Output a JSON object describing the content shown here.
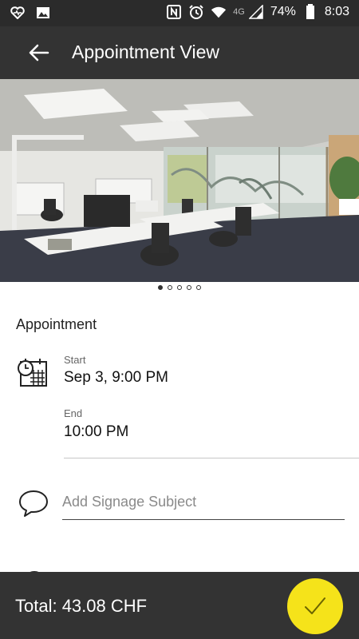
{
  "status_bar": {
    "icons_left": [
      "heart-pulse-icon",
      "image-icon"
    ],
    "icons_right": [
      "nfc-icon",
      "alarm-icon",
      "wifi-icon",
      "signal-icon",
      "battery-icon"
    ],
    "network": "4G",
    "battery": "74%",
    "time": "8:03"
  },
  "app_bar": {
    "title": "Appointment View",
    "back_icon": "arrow-left-icon"
  },
  "carousel": {
    "image": "office-photo",
    "pages": 5,
    "current": 1
  },
  "appointment": {
    "section_title": "Appointment",
    "start_label": "Start",
    "start_value": "Sep 3, 9:00 PM",
    "end_label": "End",
    "end_value": "10:00 PM"
  },
  "signage": {
    "placeholder": "Add Signage Subject",
    "value": ""
  },
  "footer": {
    "total": "Total: 43.08 CHF",
    "confirm_icon": "check-icon"
  },
  "colors": {
    "bar": "#333333",
    "status_bar": "#2b2b2b",
    "accent": "#f5e31a"
  }
}
